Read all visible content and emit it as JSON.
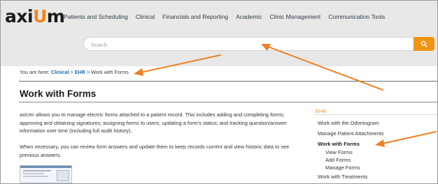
{
  "header": {
    "logo": {
      "part1": "axi",
      "part2": "U",
      "part3": "m"
    },
    "nav": [
      "Patients and Scheduling",
      "Clinical",
      "Financials and Reporting",
      "Academic",
      "Clinic Management",
      "Communication Tools"
    ],
    "search": {
      "placeholder": "Search"
    }
  },
  "breadcrumb": {
    "prefix": "You are here:",
    "items": [
      "Clinical",
      "EHR",
      "Work with Forms"
    ],
    "separator": ">"
  },
  "main": {
    "title": "Work with Forms",
    "paragraphs": [
      "axiUm allows you to manage electric forms attached to a patient record. This includes adding and completing forms; approving and obtaining signatures; assigning forms to users; updating a form's status; and tracking question/answer information over time (including full audit history).",
      "When necessary, you can review form answers and update them to keep records current and view historic data to see previous answers."
    ]
  },
  "sidebar": {
    "heading": "EHR",
    "items": [
      "Work with the Odontogram",
      "Manage Patient Attachments",
      "Work with Forms",
      "View Forms",
      "Add Forms",
      "Manage Forms",
      "Work with Treatments"
    ]
  },
  "colors": {
    "accent": "#f39314",
    "link": "#1a6fb5",
    "annotation_arrow": "#f07f22",
    "header_bg": "#e8e8e8"
  },
  "icons": {
    "search_button": "search-icon"
  }
}
